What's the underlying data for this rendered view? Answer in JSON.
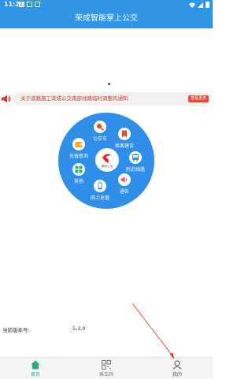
{
  "status_bar": {
    "time": "11:29"
  },
  "header": {
    "title": "荣成智能掌上公交"
  },
  "notice": {
    "text": "关于道路施工荣成公交南部线路临时调整的通知",
    "more_label": "查看更多"
  },
  "menu": {
    "items": [
      {
        "label": "公交车",
        "icon": "search-icon"
      },
      {
        "label": "乘客建议",
        "icon": "bookmark-icon"
      },
      {
        "label": "充值查询",
        "icon": "wallet-icon"
      },
      {
        "label": "附近线路",
        "icon": "bus-icon"
      },
      {
        "label": "其他",
        "icon": "grid-icon"
      },
      {
        "label": "通告",
        "icon": "speaker-icon"
      },
      {
        "label": "网上充值",
        "icon": "phone-icon"
      }
    ],
    "logo_text": "荣成公交"
  },
  "version": {
    "label": "当前版本号:",
    "value": "5.3.0"
  },
  "tabs": [
    {
      "label": "首页",
      "icon": "home-icon",
      "active": true
    },
    {
      "label": "乘车码",
      "icon": "qr-code-icon",
      "active": false
    },
    {
      "label": "我的",
      "icon": "user-icon",
      "active": false
    }
  ],
  "colors": {
    "primary": "#2f95e6",
    "circle": "#2f8ee8",
    "notice_text": "#e03a2f",
    "tab_active": "#2aa98c",
    "annotation_arrow": "#e53935"
  }
}
